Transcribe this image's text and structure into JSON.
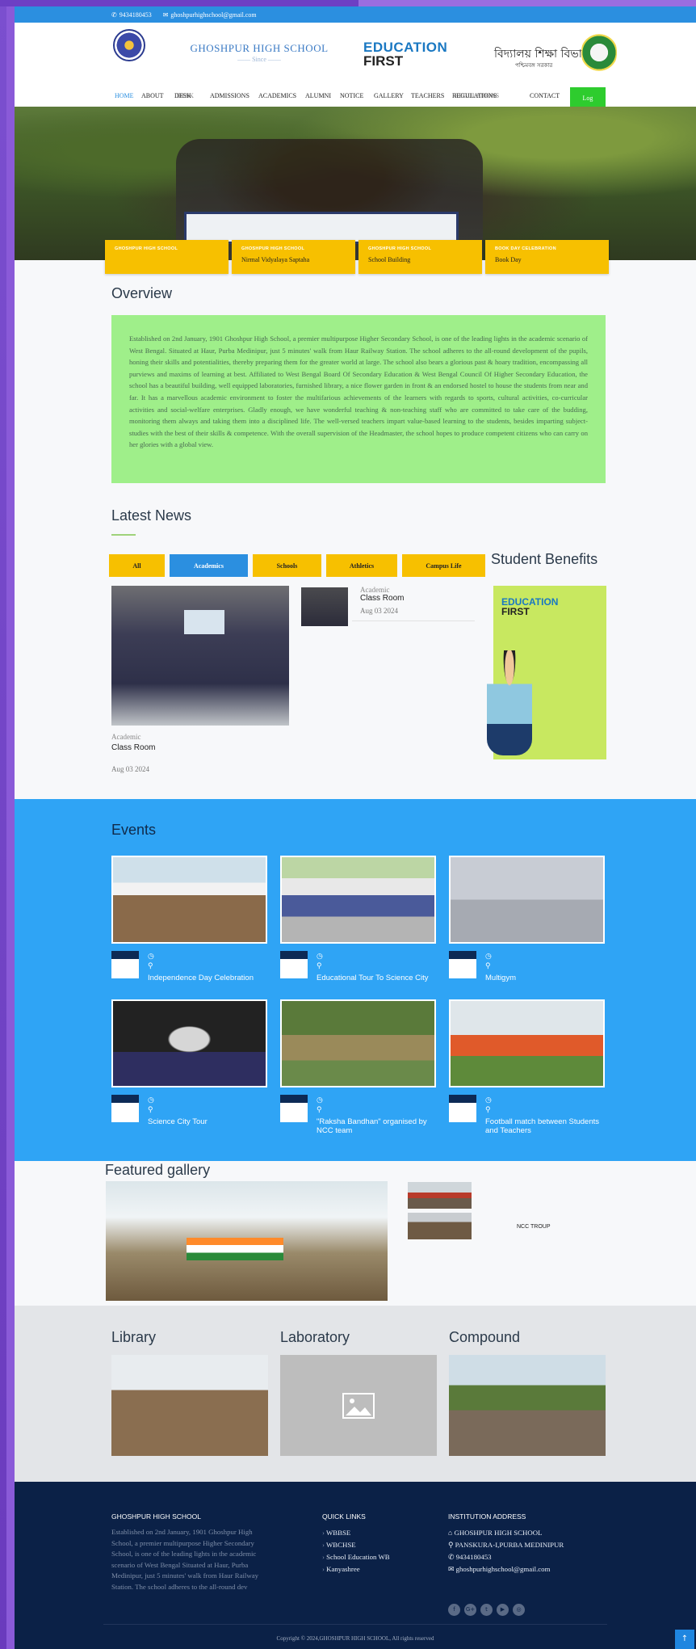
{
  "topbar": {
    "phone": "9434180453",
    "email": "ghoshpurhighschool@gmail.com"
  },
  "header": {
    "school_name": "GHOSHPUR HIGH SCHOOL",
    "since": "—— Since ——",
    "edu_line1": "EDUCATION",
    "edu_line2": "FIRST",
    "bengal_title": "বিদ্যালয় শিক্ষা বিভাগ",
    "bengal_sub": "পশ্চিমবঙ্গ সরকার"
  },
  "nav": {
    "items": [
      "HOME",
      "ABOUT",
      "DESK",
      "ADMISSIONS",
      "ACADEMICS",
      "ALUMNI",
      "NOTICE",
      "GALLERY",
      "TEACHERS",
      "REGULATIONS",
      "CONTACT"
    ],
    "overlap_1": "DESK",
    "overlap_2": "REGULATIONS",
    "login": "Log"
  },
  "slides": [
    {
      "kicker": "GHOSHPUR HIGH SCHOOL",
      "title": ""
    },
    {
      "kicker": "GHOSHPUR HIGH SCHOOL",
      "title": "Nirmal Vidyalaya Saptaha"
    },
    {
      "kicker": "GHOSHPUR HIGH SCHOOL",
      "title": "School Building"
    },
    {
      "kicker": "BOOK DAY CELEBRATION",
      "title": "Book Day"
    }
  ],
  "overview": {
    "heading": "Overview",
    "text": "Established on 2nd January, 1901 Ghoshpur High School, a premier multipurpose Higher Secondary School, is one of the leading lights in the academic scenario of West Bengal. Situated at Haur, Purba Medinipur, just 5 minutes' walk from Haur Railway Station. The school adheres to the all-round development of the pupils, honing their skills and potentialities, thereby preparing them for the greater world at large. The school also bears a glorious past & hoary tradition, encompassing all purviews and maxims of learning at best. Affiliated to West Bengal Board Of Secondary Education & West Bengal Council Of Higher Secondary Education, the school has a beautiful building, well equipped laboratories, furnished library, a nice flower garden in front & an endorsed hostel to house the students from near and far. It has a marvellous academic environment to foster the multifarious achievements of the learners with regards to sports, cultural activities, co-curricular activities and social-welfare enterprises. Gladly enough, we have wonderful teaching & non-teaching staff who are committed to take care of the budding, monitoring them always and taking them into a disciplined life. The well-versed teachers impart value-based learning to the students, besides imparting subject-studies with the best of their skills & competence. With the overall supervision of the Headmaster, the school hopes to produce competent citizens who can carry on her glories with a global view."
  },
  "news": {
    "heading": "Latest News",
    "tabs": [
      "All",
      "Academics",
      "Schools",
      "Athletics",
      "Campus Life"
    ],
    "active_tab": "Academics",
    "big": {
      "category": "Academic",
      "title": "Class Room",
      "date": "Aug 03 2024"
    },
    "small": {
      "category": "Academic",
      "title": "Class Room",
      "date": "Aug 03 2024"
    }
  },
  "benefits": {
    "heading": "Student Benefits",
    "poster_l1": "EDUCATION",
    "poster_l2": "FIRST"
  },
  "events": {
    "heading": "Events",
    "items": [
      {
        "title": "Independence Day Celebration"
      },
      {
        "title": "Educational Tour To Science City"
      },
      {
        "title": "Multigym"
      },
      {
        "title": "Science City Tour"
      },
      {
        "title": "\"Raksha Bandhan\" organised by NCC team"
      },
      {
        "title": "Football match between Students and Teachers"
      }
    ]
  },
  "gallery": {
    "heading": "Featured gallery",
    "caption": "NCC TROUP"
  },
  "facilities": {
    "items": [
      "Library",
      "Laboratory",
      "Compound"
    ]
  },
  "footer": {
    "about_heading": "GHOSHPUR HIGH SCHOOL",
    "about_text": "Established on 2nd January, 1901 Ghoshpur High School, a premier multipurpose Higher Secondary School, is one of the leading lights in the academic scenario of West Bengal Situated at Haur, Purba Medinipur, just 5 minutes' walk from Haur Railway Station. The school adheres to the all-round dev",
    "links_heading": "QUICK LINKS",
    "links": [
      "WBBSE",
      "WBCHSE",
      "School Education WB",
      "Kanyashree"
    ],
    "address_heading": "INSTITUTION ADDRESS",
    "address": {
      "name": "GHOSHPUR HIGH SCHOOL",
      "place": "PANSKURA-I,PURBA MEDINIPUR",
      "phone": "9434180453",
      "email": "ghoshpurhighschool@gmail.com"
    },
    "social": [
      "f",
      "G+",
      "t",
      "▶",
      "◎"
    ],
    "copyright": "Copyright © 2024,GHOSHPUR HIGH SCHOOL, All rights reserved"
  },
  "icons": {
    "to_top": "arrow-up-icon"
  },
  "colors": {
    "accent": "#2b8fe0",
    "yellow": "#f7c000",
    "green": "#9fef8a",
    "footer": "#0b2147",
    "events": "#2fa4f5"
  }
}
